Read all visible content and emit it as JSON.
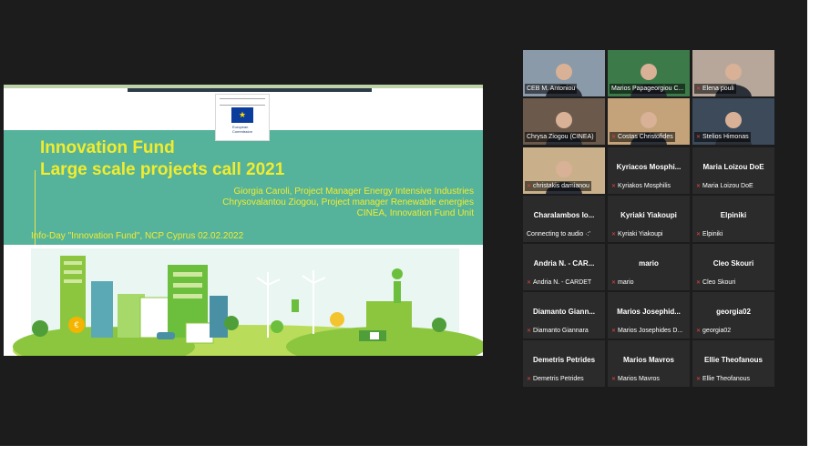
{
  "slide": {
    "title_line1": "Innovation Fund",
    "title_line2": "Large scale projects call 2021",
    "presenter1": "Giorgia Caroli, Project Manager Energy Intensive Industries",
    "presenter2": "Chrysovalantou Ziogou, Project manager Renewable energies",
    "unit": "CINEA, Innovation Fund Unit",
    "infoday": "Info-Day \"Innovation Fund\", NCP Cyprus 02.02.2022",
    "logo_caption": "European Commission"
  },
  "colors": {
    "band": "#55b39c",
    "title": "#f2ec2c",
    "active_speaker": "#c8e85a",
    "muted": "#e0473d"
  },
  "participants": [
    {
      "label": "CEB M. Antoniou",
      "big": "",
      "video": true,
      "active": true
    },
    {
      "label": "Marios Papageorgiou C...",
      "big": "",
      "video": true
    },
    {
      "label": "Elena pouli",
      "big": "",
      "video": true,
      "muted": true
    },
    {
      "label": "Chrysa Ziogou (CINEA)",
      "big": "",
      "video": true
    },
    {
      "label": "Costas Christofides",
      "big": "",
      "video": true,
      "muted": true
    },
    {
      "label": "Stelios Himonas",
      "big": "",
      "video": true,
      "muted": true
    },
    {
      "label": "christakis damianou",
      "big": "",
      "video": true,
      "muted": true
    },
    {
      "label": "Kyriakos Mosphilis",
      "big": "Kyriacos  Mosphi...",
      "muted": true
    },
    {
      "label": "Maria Loizou DoE",
      "big": "Maria Loizou DoE",
      "muted": true
    },
    {
      "label": "Connecting to audio ·:'",
      "big": "Charalambos   Io..."
    },
    {
      "label": "Kyriaki Yiakoupi",
      "big": "Kyriaki Yiakoupi",
      "muted": true
    },
    {
      "label": "Elpiniki",
      "big": "Elpiniki",
      "muted": true
    },
    {
      "label": "Andria N. - CARDET",
      "big": "Andria N. - CAR...",
      "muted": true
    },
    {
      "label": "mario",
      "big": "mario",
      "muted": true
    },
    {
      "label": "Cleo Skouri",
      "big": "Cleo Skouri",
      "muted": true
    },
    {
      "label": "Diamanto Giannara",
      "big": "Diamanto  Giann...",
      "muted": true
    },
    {
      "label": "Marios Josephides D...",
      "big": "Marios   Josephid...",
      "muted": true
    },
    {
      "label": "georgia02",
      "big": "georgia02",
      "muted": true
    },
    {
      "label": "Demetris Petrides",
      "big": "Demetris Petrides",
      "muted": true
    },
    {
      "label": "Marios Mavros",
      "big": "Marios Mavros",
      "muted": true
    },
    {
      "label": "Ellie Theofanous",
      "big": "Ellie Theofanous",
      "muted": true
    }
  ]
}
